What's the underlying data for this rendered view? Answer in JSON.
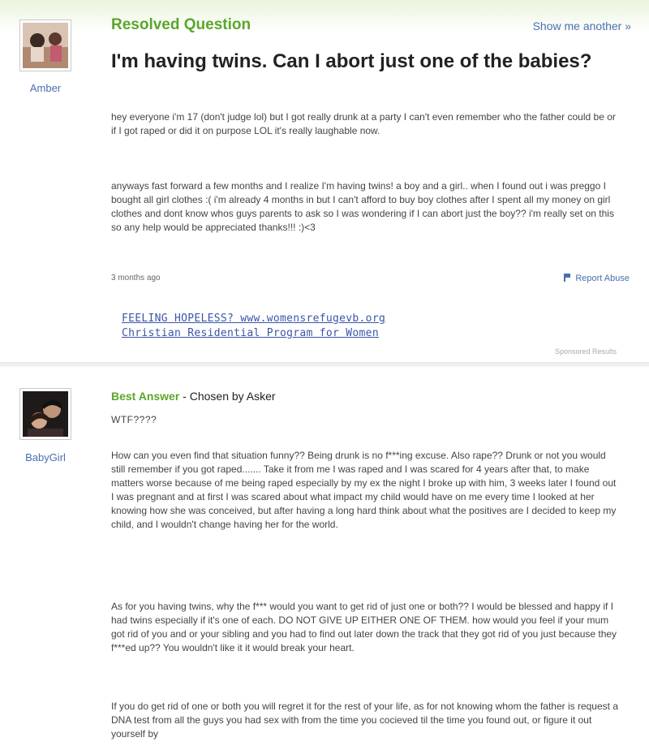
{
  "question": {
    "status": "Resolved Question",
    "show_another": "Show me another »",
    "asker": "Amber",
    "title": "I'm having twins. Can I abort just one of the babies?",
    "body": [
      "hey everyone i'm 17 (don't judge lol) but I got really drunk at a party I can't even remember who the father could be or if I got raped or did it on purpose LOL it's really laughable now.",
      "anyways fast forward a few months and I realize I'm having twins! a boy and a girl.. when I found out i was preggo I bought all girl clothes :( i'm already 4 months in but I can't afford to buy boy clothes after I spent all my money on girl clothes and dont know whos guys parents to ask so I was wondering if I can abort just the boy?? i'm really set on this so any help would be appreciated thanks!!! :)<3"
    ],
    "time": "3 months ago",
    "report": "Report Abuse"
  },
  "sponsored": {
    "line1": "FEELING HOPELESS? www.womensrefugevb.org",
    "line2": "Christian Residential Program for Women",
    "label": "Sponsored Results"
  },
  "answer": {
    "label": "Best Answer",
    "chosen": " - Chosen by Asker",
    "user": "BabyGirl",
    "lead": "WTF????",
    "body": [
      "How can you even find that situation funny?? Being drunk is no f***ing excuse. Also rape?? Drunk or not you would still remember if you got raped....... Take it from me I was raped and I was scared for 4 years after that, to make matters worse because of me being raped especially by my ex the night I broke up with him, 3 weeks later I found out I was pregnant and at first I was scared about what impact my child would have on me every time I looked at her knowing how she was conceived, but after having a long hard think about what the positives are I decided to keep my child, and I wouldn't change having her for the world.",
      "As for you having twins, why the f*** would you want to get rid of just one or both?? I would be blessed and happy if I had twins especially if it's one of each. DO NOT GIVE UP EITHER ONE OF THEM. how would you feel if your mum got rid of you and or your sibling and you had to find out later down the track that they got rid of you just because they f***ed up?? You wouldn't like it it would break your heart.",
      "If you do get rid of one or both you will regret it for the rest of your life, as for not knowing whom the father is request a DNA test from all the guys you had sex with from the time you cocieved til the time you found out, or figure it out yourself by"
    ]
  },
  "colors": {
    "green": "#5aa72a",
    "link": "#4a6fb0"
  }
}
